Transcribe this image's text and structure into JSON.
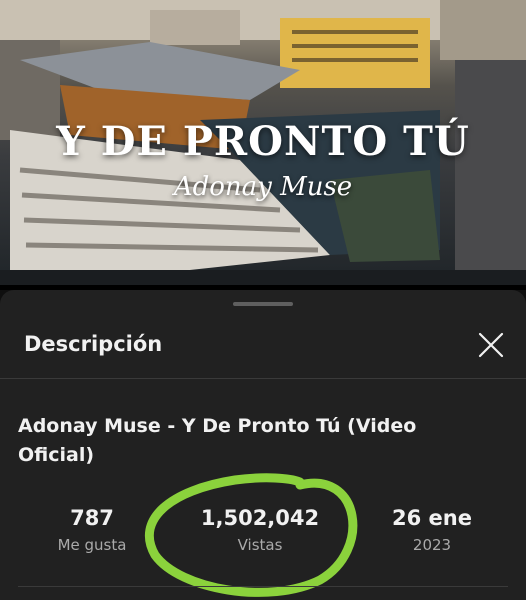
{
  "video": {
    "title": "Y DE PRONTO TÚ",
    "artist": "Adonay Muse"
  },
  "panel": {
    "heading": "Descripción",
    "video_title": "Adonay Muse - Y De Pronto Tú (Video Oficial)",
    "stats": [
      {
        "value": "787",
        "label": "Me gusta"
      },
      {
        "value": "1,502,042",
        "label": "Vistas"
      },
      {
        "value": "26 ene",
        "label": "2023"
      }
    ],
    "highlight_color": "#8bd23c"
  }
}
